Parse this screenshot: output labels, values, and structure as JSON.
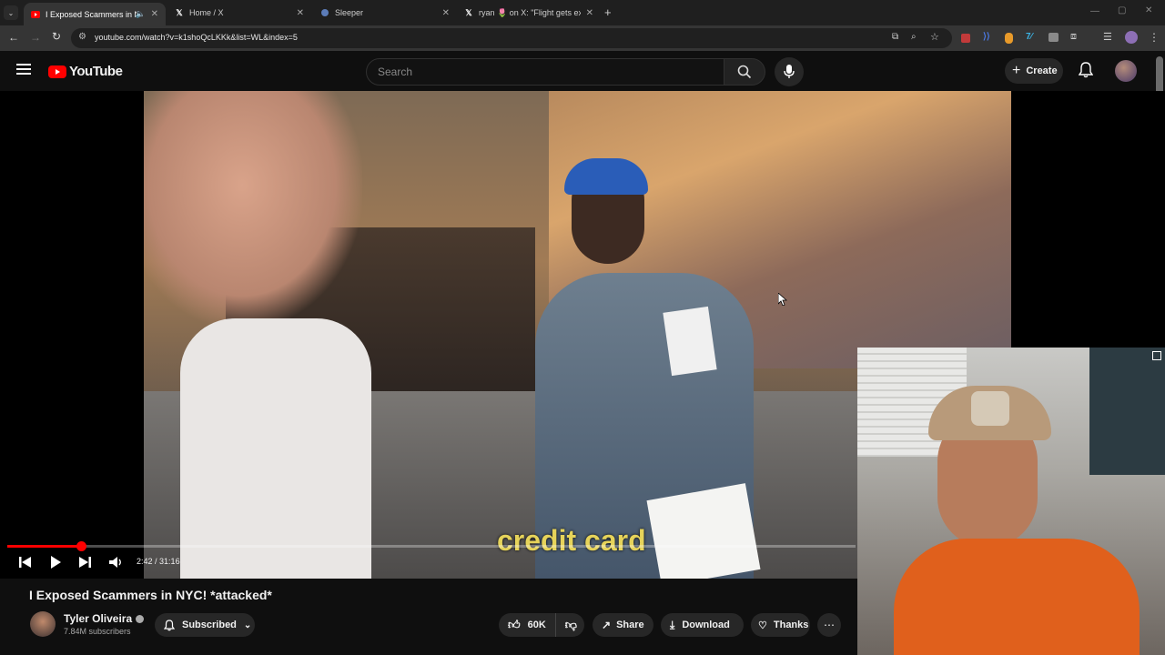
{
  "browser": {
    "tabs": [
      {
        "title": "I Exposed Scammers in NYC",
        "icon": "youtube-icon",
        "active": true
      },
      {
        "title": "Home / X",
        "icon": "x-icon",
        "active": false
      },
      {
        "title": "Sleeper",
        "icon": "sleeper-icon",
        "active": false
      },
      {
        "title": "ryan 🌷 on X: \"Flight gets excit",
        "icon": "x-icon",
        "active": false
      }
    ],
    "url": "youtube.com/watch?v=k1shoQcLKKk&list=WL&index=5"
  },
  "youtube": {
    "logo_text": "YouTube",
    "search_placeholder": "Search",
    "create_label": "Create"
  },
  "player": {
    "caption": "credit card",
    "time_current": "2:42",
    "time_total": "31:16",
    "progress_fraction": 0.0866,
    "progress_color": "#ff0000"
  },
  "video": {
    "title": "I Exposed Scammers in NYC! *attacked*",
    "channel_name": "Tyler Oliveira",
    "subscribers": "7.84M subscribers",
    "subscribed_label": "Subscribed",
    "likes": "60K",
    "share_label": "Share",
    "download_label": "Download",
    "thanks_label": "Thanks"
  }
}
